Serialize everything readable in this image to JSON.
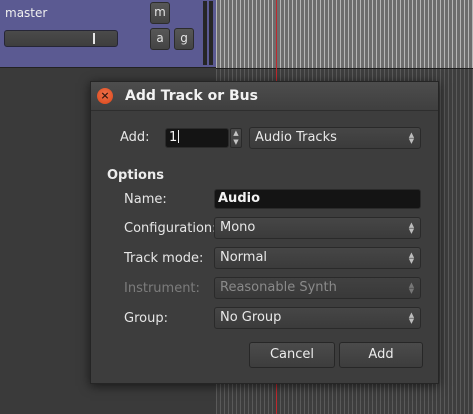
{
  "track": {
    "name": "master",
    "buttons": {
      "mute": "m",
      "automation": "a",
      "group": "g"
    }
  },
  "dialog": {
    "title": "Add Track or Bus",
    "close_icon": "×",
    "add_label": "Add:",
    "add_count": "1",
    "add_type": "Audio Tracks",
    "options_heading": "Options",
    "name_label": "Name:",
    "name_value": "Audio",
    "configuration_label": "Configuration:",
    "configuration_value": "Mono",
    "track_mode_label": "Track mode:",
    "track_mode_value": "Normal",
    "instrument_label": "Instrument:",
    "instrument_value": "Reasonable Synth",
    "group_label": "Group:",
    "group_value": "No Group",
    "cancel_label": "Cancel",
    "add_button_label": "Add"
  },
  "colors": {
    "track_header": "#5b5a92",
    "playhead": "#c0282d",
    "close_button": "#e4592c"
  }
}
